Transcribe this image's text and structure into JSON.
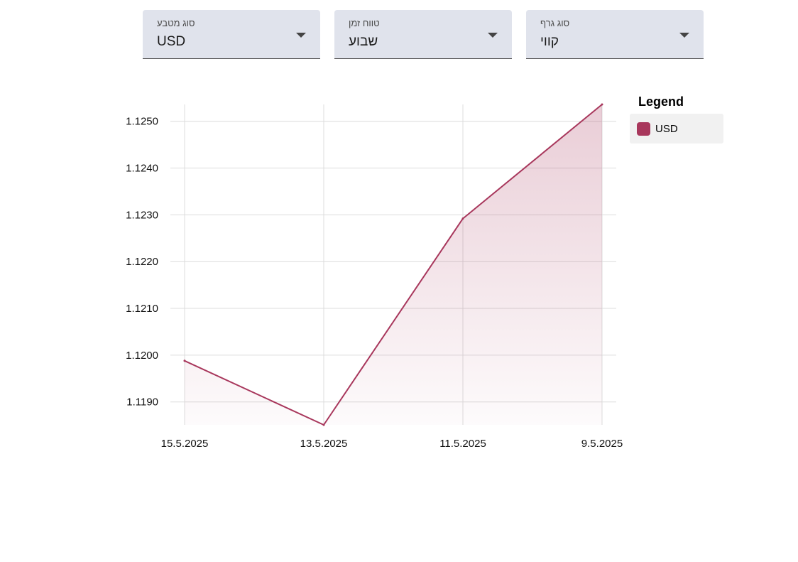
{
  "controls": [
    {
      "label": "סוג מטבע",
      "value": "USD"
    },
    {
      "label": "טווח זמן",
      "value": "שבוע"
    },
    {
      "label": "סוג גרף",
      "value": "קווי"
    }
  ],
  "legend": {
    "title": "Legend",
    "items": [
      {
        "label": "USD",
        "color": "#a8375c"
      }
    ]
  },
  "chart_data": {
    "type": "area",
    "x": [
      "15.5.2025",
      "13.5.2025",
      "11.5.2025",
      "9.5.2025"
    ],
    "series": [
      {
        "name": "USD",
        "color": "#a8375c",
        "values": [
          1.11988,
          1.11851,
          1.12292,
          1.12536
        ]
      }
    ],
    "y_ticks": [
      "1.1190",
      "1.1200",
      "1.1210",
      "1.1220",
      "1.1230",
      "1.1240",
      "1.1250"
    ],
    "ylim": [
      1.11851,
      1.12536
    ],
    "grid": true,
    "legend_position": "right"
  }
}
